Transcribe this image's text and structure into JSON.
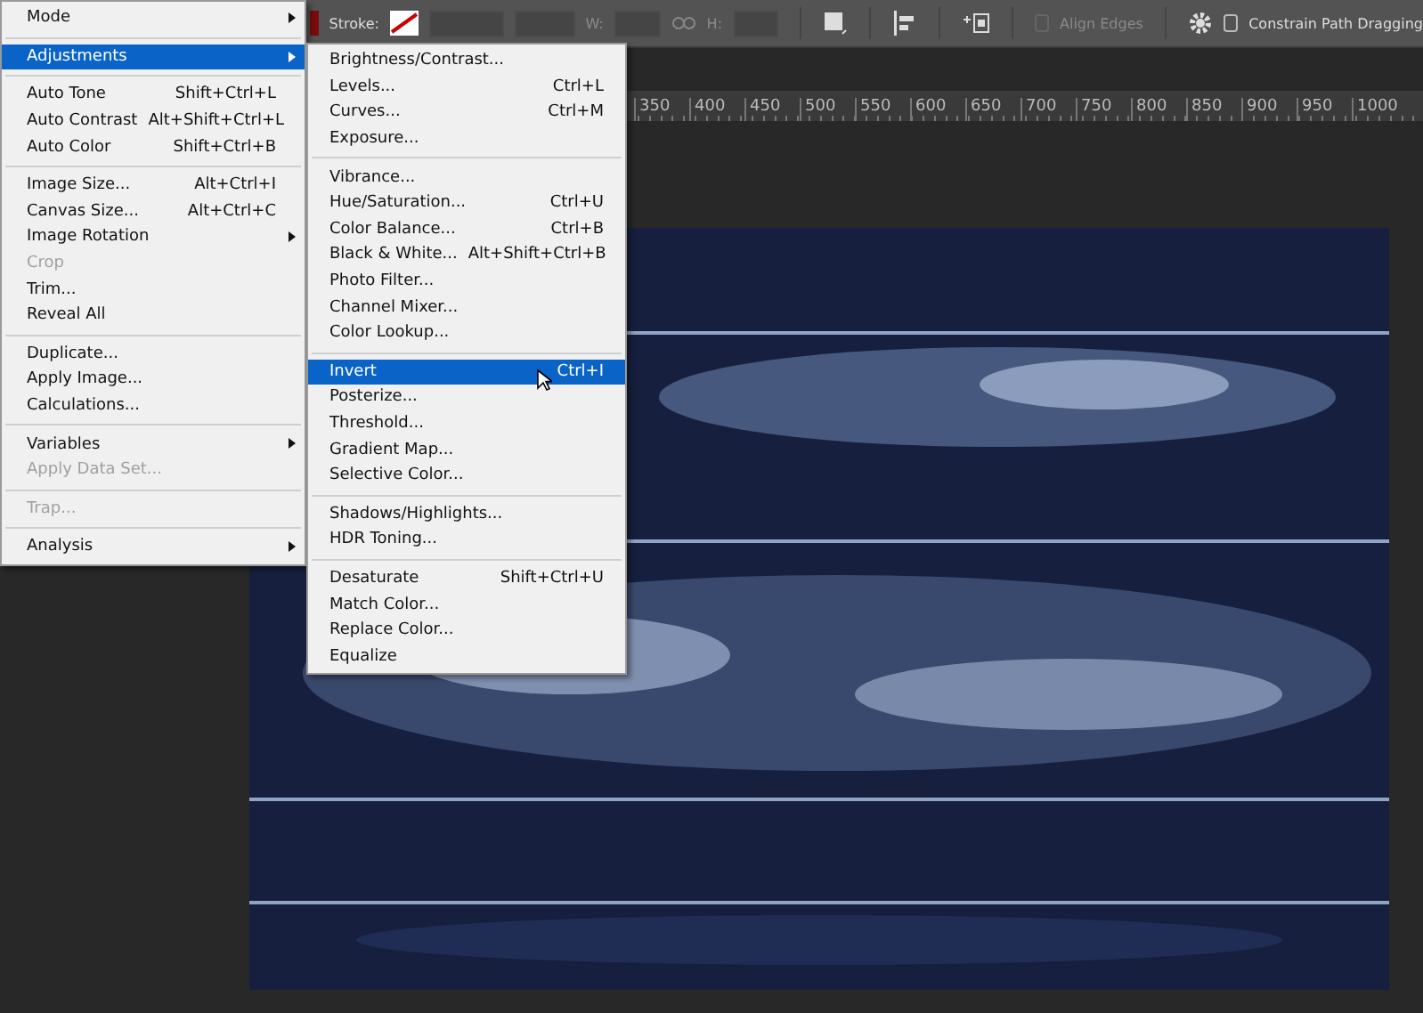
{
  "options_bar": {
    "stroke_label": "Stroke:",
    "width_label": "W:",
    "height_label": "H:",
    "align_edges": {
      "label": "Align Edges",
      "checked": false,
      "disabled": true
    },
    "constrain": {
      "label": "Constrain Path Dragging",
      "checked": false,
      "disabled": false
    }
  },
  "ruler": {
    "labels": [
      "350",
      "400",
      "450",
      "500",
      "550",
      "600",
      "650",
      "700",
      "750",
      "800",
      "850",
      "900",
      "950",
      "1000"
    ]
  },
  "image_menu": [
    {
      "kind": "item",
      "label": "Mode",
      "submenu": true,
      "disabled": false,
      "selected": false
    },
    {
      "kind": "separator"
    },
    {
      "kind": "item",
      "label": "Adjustments",
      "submenu": true,
      "disabled": false,
      "selected": true
    },
    {
      "kind": "separator"
    },
    {
      "kind": "item",
      "label": "Auto Tone",
      "shortcut": "Shift+Ctrl+L",
      "submenu": false,
      "disabled": false,
      "selected": false
    },
    {
      "kind": "item",
      "label": "Auto Contrast",
      "shortcut": "Alt+Shift+Ctrl+L",
      "submenu": false,
      "disabled": false,
      "selected": false
    },
    {
      "kind": "item",
      "label": "Auto Color",
      "shortcut": "Shift+Ctrl+B",
      "submenu": false,
      "disabled": false,
      "selected": false
    },
    {
      "kind": "separator"
    },
    {
      "kind": "item",
      "label": "Image Size...",
      "shortcut": "Alt+Ctrl+I",
      "submenu": false,
      "disabled": false,
      "selected": false
    },
    {
      "kind": "item",
      "label": "Canvas Size...",
      "shortcut": "Alt+Ctrl+C",
      "submenu": false,
      "disabled": false,
      "selected": false
    },
    {
      "kind": "item",
      "label": "Image Rotation",
      "submenu": true,
      "disabled": false,
      "selected": false
    },
    {
      "kind": "item",
      "label": "Crop",
      "submenu": false,
      "disabled": true,
      "selected": false
    },
    {
      "kind": "item",
      "label": "Trim...",
      "submenu": false,
      "disabled": false,
      "selected": false
    },
    {
      "kind": "item",
      "label": "Reveal All",
      "submenu": false,
      "disabled": false,
      "selected": false
    },
    {
      "kind": "separator"
    },
    {
      "kind": "item",
      "label": "Duplicate...",
      "submenu": false,
      "disabled": false,
      "selected": false
    },
    {
      "kind": "item",
      "label": "Apply Image...",
      "submenu": false,
      "disabled": false,
      "selected": false
    },
    {
      "kind": "item",
      "label": "Calculations...",
      "submenu": false,
      "disabled": false,
      "selected": false
    },
    {
      "kind": "separator"
    },
    {
      "kind": "item",
      "label": "Variables",
      "submenu": true,
      "disabled": false,
      "selected": false
    },
    {
      "kind": "item",
      "label": "Apply Data Set...",
      "submenu": false,
      "disabled": true,
      "selected": false
    },
    {
      "kind": "separator"
    },
    {
      "kind": "item",
      "label": "Trap...",
      "submenu": false,
      "disabled": true,
      "selected": false
    },
    {
      "kind": "separator"
    },
    {
      "kind": "item",
      "label": "Analysis",
      "submenu": true,
      "disabled": false,
      "selected": false
    }
  ],
  "adjustments_menu": [
    {
      "kind": "item",
      "label": "Brightness/Contrast...",
      "disabled": false,
      "selected": false
    },
    {
      "kind": "item",
      "label": "Levels...",
      "shortcut": "Ctrl+L",
      "disabled": false,
      "selected": false
    },
    {
      "kind": "item",
      "label": "Curves...",
      "shortcut": "Ctrl+M",
      "disabled": false,
      "selected": false
    },
    {
      "kind": "item",
      "label": "Exposure...",
      "disabled": false,
      "selected": false
    },
    {
      "kind": "separator"
    },
    {
      "kind": "item",
      "label": "Vibrance...",
      "disabled": false,
      "selected": false
    },
    {
      "kind": "item",
      "label": "Hue/Saturation...",
      "shortcut": "Ctrl+U",
      "disabled": false,
      "selected": false
    },
    {
      "kind": "item",
      "label": "Color Balance...",
      "shortcut": "Ctrl+B",
      "disabled": false,
      "selected": false
    },
    {
      "kind": "item",
      "label": "Black & White...",
      "shortcut": "Alt+Shift+Ctrl+B",
      "disabled": false,
      "selected": false
    },
    {
      "kind": "item",
      "label": "Photo Filter...",
      "disabled": false,
      "selected": false
    },
    {
      "kind": "item",
      "label": "Channel Mixer...",
      "disabled": false,
      "selected": false
    },
    {
      "kind": "item",
      "label": "Color Lookup...",
      "disabled": false,
      "selected": false
    },
    {
      "kind": "separator"
    },
    {
      "kind": "item",
      "label": "Invert",
      "shortcut": "Ctrl+I",
      "disabled": false,
      "selected": true
    },
    {
      "kind": "item",
      "label": "Posterize...",
      "disabled": false,
      "selected": false
    },
    {
      "kind": "item",
      "label": "Threshold...",
      "disabled": false,
      "selected": false
    },
    {
      "kind": "item",
      "label": "Gradient Map...",
      "disabled": false,
      "selected": false
    },
    {
      "kind": "item",
      "label": "Selective Color...",
      "disabled": false,
      "selected": false
    },
    {
      "kind": "separator"
    },
    {
      "kind": "item",
      "label": "Shadows/Highlights...",
      "disabled": false,
      "selected": false
    },
    {
      "kind": "item",
      "label": "HDR Toning...",
      "disabled": false,
      "selected": false
    },
    {
      "kind": "separator"
    },
    {
      "kind": "item",
      "label": "Desaturate",
      "shortcut": "Shift+Ctrl+U",
      "disabled": false,
      "selected": false
    },
    {
      "kind": "item",
      "label": "Match Color...",
      "disabled": false,
      "selected": false
    },
    {
      "kind": "item",
      "label": "Replace Color...",
      "disabled": false,
      "selected": false
    },
    {
      "kind": "item",
      "label": "Equalize",
      "disabled": false,
      "selected": false
    }
  ]
}
